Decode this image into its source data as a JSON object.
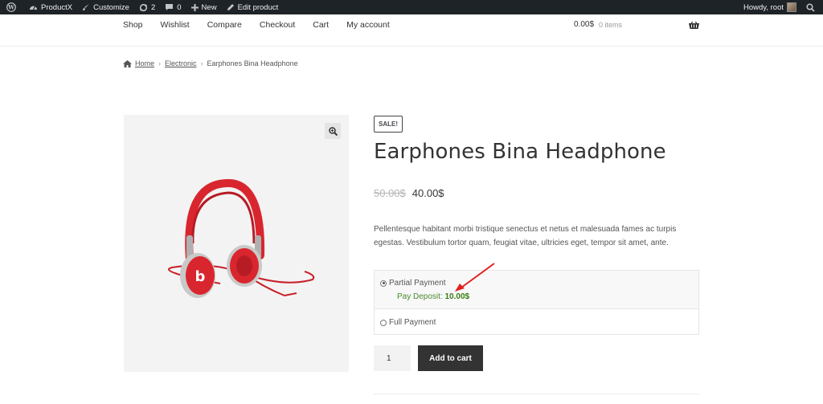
{
  "admin_bar": {
    "site_name": "ProductX",
    "customize": "Customize",
    "updates_count": "2",
    "comments_count": "0",
    "new_label": "New",
    "edit_label": "Edit product",
    "howdy": "Howdy, root"
  },
  "nav": {
    "items": [
      "Shop",
      "Wishlist",
      "Compare",
      "Checkout",
      "Cart",
      "My account"
    ],
    "cart_total": "0.00$",
    "cart_count": "0 items"
  },
  "breadcrumb": {
    "home": "Home",
    "category": "Electronic",
    "current": "Earphones Bina Headphone"
  },
  "product": {
    "badge": "SALE!",
    "title": "Earphones Bina Headphone",
    "old_price": "50.00$",
    "new_price": "40.00$",
    "description": "Pellentesque habitant morbi tristique senectus et netus et malesuada fames ac turpis egestas. Vestibulum tortor quam, feugiat vitae, ultricies eget, tempor sit amet, ante."
  },
  "deposit": {
    "partial_label": "Partial Payment",
    "pay_deposit_label": "Pay Deposit:",
    "pay_deposit_amount": "10.00$",
    "full_label": "Full Payment",
    "selected": "partial"
  },
  "cart_form": {
    "quantity": "1",
    "add_to_cart": "Add to cart"
  },
  "colors": {
    "admin_bar": "#1d2327",
    "button": "#333333",
    "deposit_text": "#4a8a2a",
    "arrow": "#e02020",
    "headphone": "#d9262e"
  }
}
